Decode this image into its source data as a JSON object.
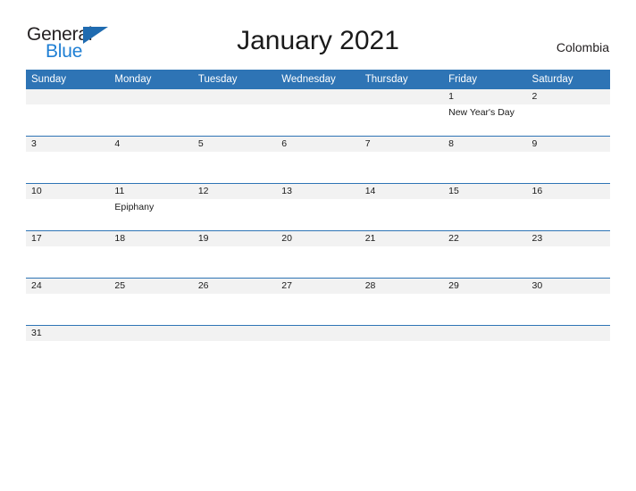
{
  "brand": {
    "line1": "General",
    "line2": "Blue",
    "triangle_color": "#1f6bb0",
    "line2_color": "#1f7fd4"
  },
  "header": {
    "title": "January 2021",
    "country": "Colombia"
  },
  "theme": {
    "header_blue": "#2e74b5",
    "daynum_gray": "#f2f2f2",
    "row_rule": "#2e74b5"
  },
  "calendar": {
    "weekday_headers": [
      "Sunday",
      "Monday",
      "Tuesday",
      "Wednesday",
      "Thursday",
      "Friday",
      "Saturday"
    ],
    "weeks": [
      [
        {
          "date": "",
          "event": ""
        },
        {
          "date": "",
          "event": ""
        },
        {
          "date": "",
          "event": ""
        },
        {
          "date": "",
          "event": ""
        },
        {
          "date": "",
          "event": ""
        },
        {
          "date": "1",
          "event": "New Year's Day"
        },
        {
          "date": "2",
          "event": ""
        }
      ],
      [
        {
          "date": "3",
          "event": ""
        },
        {
          "date": "4",
          "event": ""
        },
        {
          "date": "5",
          "event": ""
        },
        {
          "date": "6",
          "event": ""
        },
        {
          "date": "7",
          "event": ""
        },
        {
          "date": "8",
          "event": ""
        },
        {
          "date": "9",
          "event": ""
        }
      ],
      [
        {
          "date": "10",
          "event": ""
        },
        {
          "date": "11",
          "event": "Epiphany"
        },
        {
          "date": "12",
          "event": ""
        },
        {
          "date": "13",
          "event": ""
        },
        {
          "date": "14",
          "event": ""
        },
        {
          "date": "15",
          "event": ""
        },
        {
          "date": "16",
          "event": ""
        }
      ],
      [
        {
          "date": "17",
          "event": ""
        },
        {
          "date": "18",
          "event": ""
        },
        {
          "date": "19",
          "event": ""
        },
        {
          "date": "20",
          "event": ""
        },
        {
          "date": "21",
          "event": ""
        },
        {
          "date": "22",
          "event": ""
        },
        {
          "date": "23",
          "event": ""
        }
      ],
      [
        {
          "date": "24",
          "event": ""
        },
        {
          "date": "25",
          "event": ""
        },
        {
          "date": "26",
          "event": ""
        },
        {
          "date": "27",
          "event": ""
        },
        {
          "date": "28",
          "event": ""
        },
        {
          "date": "29",
          "event": ""
        },
        {
          "date": "30",
          "event": ""
        }
      ],
      [
        {
          "date": "31",
          "event": ""
        },
        {
          "date": "",
          "event": ""
        },
        {
          "date": "",
          "event": ""
        },
        {
          "date": "",
          "event": ""
        },
        {
          "date": "",
          "event": ""
        },
        {
          "date": "",
          "event": ""
        },
        {
          "date": "",
          "event": ""
        }
      ]
    ]
  }
}
